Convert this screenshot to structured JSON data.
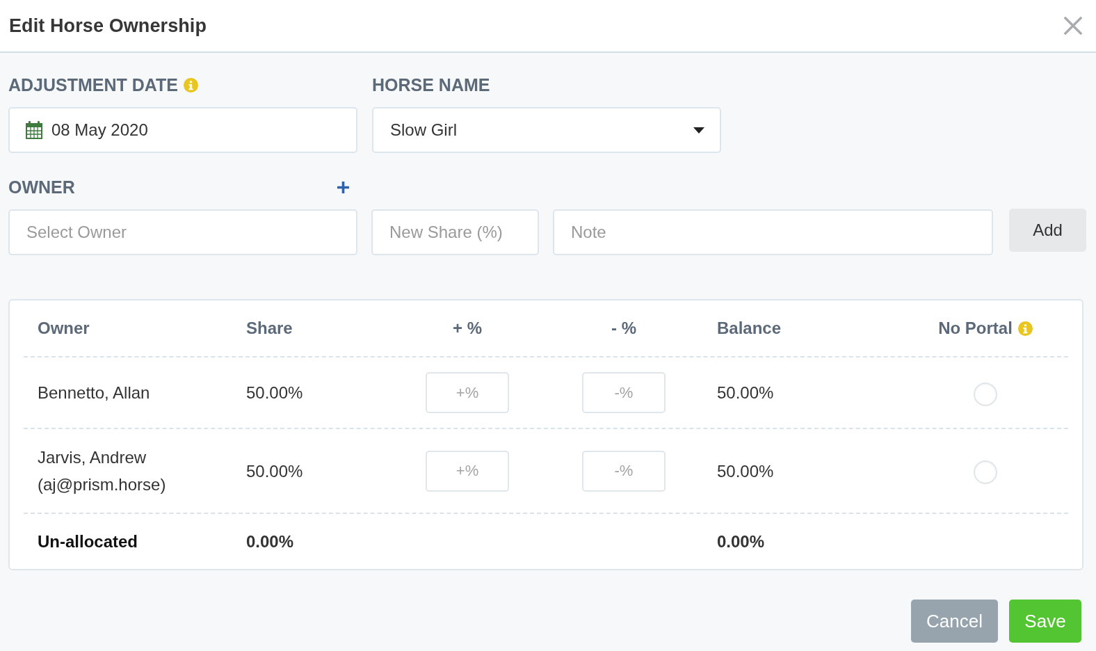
{
  "dialog": {
    "title": "Edit Horse Ownership"
  },
  "form": {
    "adjustment_date": {
      "label": "ADJUSTMENT DATE",
      "info": true,
      "value": "08 May 2020"
    },
    "horse_name": {
      "label": "HORSE NAME",
      "info": false,
      "value": "Slow Girl"
    },
    "owner": {
      "label": "OWNER",
      "placeholder": "Select Owner"
    },
    "new_share": {
      "placeholder": "New Share (%)"
    },
    "note": {
      "placeholder": "Note"
    },
    "add_button": {
      "label": "Add"
    }
  },
  "table": {
    "columns": [
      {
        "label": "Owner",
        "info": false
      },
      {
        "label": "Share",
        "info": false
      },
      {
        "label": "+ %",
        "info": false
      },
      {
        "label": "- %",
        "info": false
      },
      {
        "label": "Balance",
        "info": false
      },
      {
        "label": "No Portal",
        "info": true
      }
    ],
    "rows": [
      {
        "owner": "Bennetto, Allan",
        "share": "50.00%",
        "increase_placeholder": "+%",
        "decrease_placeholder": "-%",
        "balance": "50.00%",
        "no_portal": false
      },
      {
        "owner": "Jarvis, Andrew (aj@prism.horse)",
        "share": "50.00%",
        "increase_placeholder": "+%",
        "decrease_placeholder": "-%",
        "balance": "50.00%",
        "no_portal": false
      }
    ],
    "footer": {
      "label": "Un-allocated",
      "share": "0.00%",
      "balance": "0.00%"
    }
  },
  "actions": [
    {
      "label": "Cancel",
      "kind": "secondary"
    },
    {
      "label": "Save",
      "kind": "primary"
    }
  ]
}
